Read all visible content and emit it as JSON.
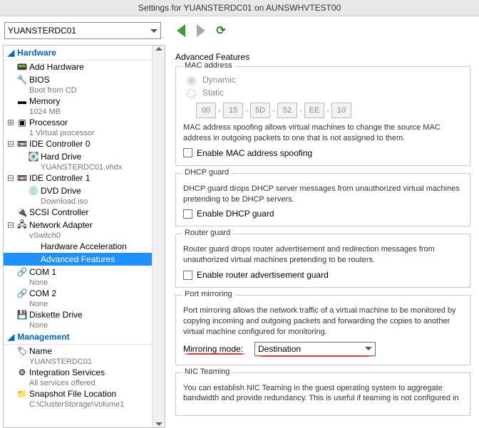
{
  "window": {
    "title": "Settings for YUANSTERDC01 on AUNSWHVTEST00"
  },
  "toolbar": {
    "selected_vm": "YUANSTERDC01"
  },
  "sidebar": {
    "hardware_label": "Hardware",
    "management_label": "Management",
    "items": {
      "add_hw": "Add Hardware",
      "bios": "BIOS",
      "bios_sub": "Boot from CD",
      "memory": "Memory",
      "memory_sub": "1024 MB",
      "processor": "Processor",
      "processor_sub": "1 Virtual processor",
      "ide0": "IDE Controller 0",
      "hdd": "Hard Drive",
      "hdd_sub": "YUANSTERDC01.vhdx",
      "ide1": "IDE Controller 1",
      "dvd": "DVD Drive",
      "dvd_sub": "Download.iso",
      "scsi": "SCSI Controller",
      "nic": "Network Adapter",
      "nic_sub": "vSwitch0",
      "hwaccel": "Hardware Acceleration",
      "advfeat": "Advanced Features",
      "com1": "COM 1",
      "com1_sub": "None",
      "com2": "COM 2",
      "com2_sub": "None",
      "disk": "Diskette Drive",
      "disk_sub": "None",
      "name": "Name",
      "name_sub": "YUANSTERDC01",
      "integ": "Integration Services",
      "integ_sub": "All services offered",
      "snap": "Snapshot File Location",
      "snap_sub": "C:\\ClusterStorage\\Volume1"
    }
  },
  "content": {
    "title": "Advanced Features",
    "mac": {
      "legend": "MAC address",
      "dynamic": "Dynamic",
      "static": "Static",
      "val": [
        "00",
        "15",
        "5D",
        "52",
        "EE",
        "10"
      ],
      "desc": "MAC address spoofing allows virtual machines to change the source MAC address in outgoing packets to one that is not assigned to them.",
      "chk": "Enable MAC address spoofing"
    },
    "dhcp": {
      "legend": "DHCP guard",
      "desc": "DHCP guard drops DHCP server messages from unauthorized virtual machines pretending to be DHCP servers.",
      "chk": "Enable DHCP guard"
    },
    "router": {
      "legend": "Router guard",
      "desc": "Router guard drops router advertisement and redirection messages from unauthorized virtual machines pretending to be routers.",
      "chk": "Enable router advertisement guard"
    },
    "mirror": {
      "legend": "Port mirroring",
      "desc": "Port mirroring allows the network traffic of a virtual machine to be monitored by copying incoming and outgoing packets and forwarding the copies to another virtual machine configured for monitoring.",
      "label": "Mirroring mode:",
      "value": "Destination"
    },
    "team": {
      "legend": "NIC Teaming",
      "desc": "You can establish NIC Teaming in the guest operating system to aggregate bandwidth and provide redundancy. This is useful if teaming is not configured in"
    }
  }
}
